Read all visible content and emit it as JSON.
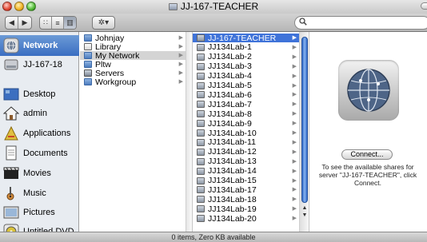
{
  "window": {
    "title": "JJ-167-TEACHER"
  },
  "toolbar": {
    "back_label": "◀",
    "forward_label": "▶",
    "view_icons": [
      "∷",
      "≡",
      "▥"
    ],
    "action_label": "✲▾",
    "search_placeholder": ""
  },
  "sidebar": {
    "items": [
      {
        "label": "Network",
        "icon": "network-globe-icon",
        "selected": true
      },
      {
        "label": "JJ-167-18",
        "icon": "hard-drive-icon",
        "selected": false
      },
      {
        "label": "Desktop",
        "icon": "desktop-icon",
        "selected": false
      },
      {
        "label": "admin",
        "icon": "home-icon",
        "selected": false
      },
      {
        "label": "Applications",
        "icon": "applications-icon",
        "selected": false
      },
      {
        "label": "Documents",
        "icon": "documents-icon",
        "selected": false
      },
      {
        "label": "Movies",
        "icon": "movies-icon",
        "selected": false
      },
      {
        "label": "Music",
        "icon": "music-icon",
        "selected": false
      },
      {
        "label": "Pictures",
        "icon": "pictures-icon",
        "selected": false
      },
      {
        "label": "Untitled DVD",
        "icon": "dvd-icon",
        "selected": false
      }
    ]
  },
  "column1": {
    "items": [
      {
        "label": "Johnjay",
        "icon": "folder",
        "selected": false
      },
      {
        "label": "Library",
        "icon": "lib",
        "selected": false
      },
      {
        "label": "My Network",
        "icon": "folder",
        "selected": "grey"
      },
      {
        "label": "Pltw",
        "icon": "folder",
        "selected": false
      },
      {
        "label": "Servers",
        "icon": "srv",
        "selected": false
      },
      {
        "label": "Workgroup",
        "icon": "folder",
        "selected": false
      }
    ]
  },
  "column2": {
    "items": [
      "JJ-167-TEACHER",
      "JJ134Lab-1",
      "JJ134Lab-2",
      "JJ134Lab-3",
      "JJ134Lab-4",
      "JJ134Lab-5",
      "JJ134Lab-6",
      "JJ134Lab-7",
      "JJ134Lab-8",
      "JJ134Lab-9",
      "JJ134Lab-10",
      "JJ134Lab-11",
      "JJ134Lab-12",
      "JJ134Lab-13",
      "JJ134Lab-14",
      "JJ134Lab-15",
      "JJ134Lab-17",
      "JJ134Lab-18",
      "JJ134Lab-19",
      "JJ134Lab-20"
    ],
    "selected_index": 0
  },
  "preview": {
    "connect_label": "Connect...",
    "help_text": "To see the available shares for server \"JJ-167-TEACHER\", click Connect."
  },
  "statusbar": {
    "text": "0 items, Zero KB available"
  },
  "colors": {
    "selection_blue": "#3f73d9",
    "sidebar_bg": "#e8ecf1"
  }
}
